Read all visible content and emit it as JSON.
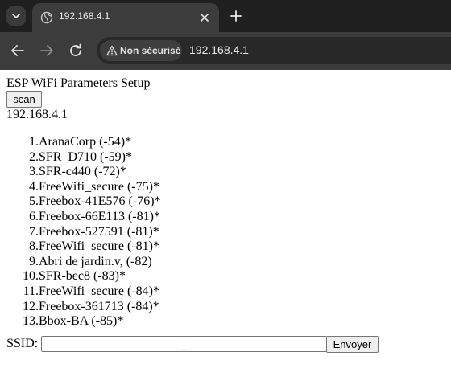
{
  "browser": {
    "tab_title": "192.168.4.1",
    "security_label": "Non sécurisé",
    "url": "192.168.4.1"
  },
  "page": {
    "title": "ESP WiFi Parameters Setup",
    "scan_label": "scan",
    "ip": "192.168.4.1",
    "networks": [
      {
        "num": "1.",
        "name": "AranaCorp (-54)*"
      },
      {
        "num": "2.",
        "name": "SFR_D710 (-59)*"
      },
      {
        "num": "3.",
        "name": "SFR-c440 (-72)*"
      },
      {
        "num": "4.",
        "name": "FreeWifi_secure (-75)*"
      },
      {
        "num": "5.",
        "name": "Freebox-41E576 (-76)*"
      },
      {
        "num": "6.",
        "name": "Freebox-66E113 (-81)*"
      },
      {
        "num": "7.",
        "name": "Freebox-527591 (-81)*"
      },
      {
        "num": "8.",
        "name": "FreeWifi_secure (-81)*"
      },
      {
        "num": "9.",
        "name": "Abri de jardin.v, (-82)"
      },
      {
        "num": "10.",
        "name": "SFR-bec8 (-83)*"
      },
      {
        "num": "11.",
        "name": "FreeWifi_secure (-84)*"
      },
      {
        "num": "12.",
        "name": "Freebox-361713 (-84)*"
      },
      {
        "num": "13.",
        "name": "Bbox-BA (-85)*"
      }
    ],
    "ssid_label": "SSID:",
    "ssid_value": "",
    "password_value": "",
    "send_label": "Envoyer"
  },
  "colors": {
    "tabstrip_bg": "#1f1f1f",
    "toolbar_bg": "#3c3c3c",
    "omnibox_bg": "#282828"
  }
}
